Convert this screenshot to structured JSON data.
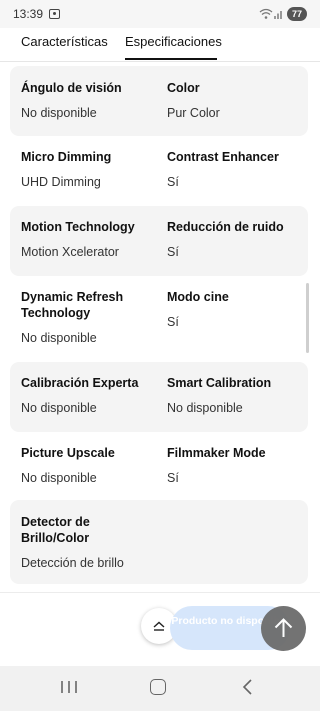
{
  "status_bar": {
    "time": "13:39",
    "battery": "77"
  },
  "tabs": [
    {
      "label": "Características"
    },
    {
      "label": "Especificaciones"
    }
  ],
  "specs": [
    {
      "cells": [
        {
          "label": "Ángulo de visión",
          "value": "No disponible"
        },
        {
          "label": "Color",
          "value": "Pur Color"
        }
      ]
    },
    {
      "cells": [
        {
          "label": "Micro Dimming",
          "value": "UHD Dimming"
        },
        {
          "label": "Contrast Enhancer",
          "value": "Sí"
        }
      ]
    },
    {
      "cells": [
        {
          "label": "Motion Technology",
          "value": "Motion Xcelerator"
        },
        {
          "label": "Reducción de ruido",
          "value": "Sí"
        }
      ]
    },
    {
      "cells": [
        {
          "label": "Dynamic Refresh Technology",
          "value": "No disponible"
        },
        {
          "label": "Modo cine",
          "value": "Sí"
        }
      ]
    },
    {
      "cells": [
        {
          "label": "Calibración Experta",
          "value": "No disponible"
        },
        {
          "label": "Smart Calibration",
          "value": "No disponible"
        }
      ]
    },
    {
      "cells": [
        {
          "label": "Picture Upscale",
          "value": "No disponible"
        },
        {
          "label": "Filmmaker Mode",
          "value": "Sí"
        }
      ]
    },
    {
      "cells": [
        {
          "label": "Detector de Brillo/Color",
          "value": "Detección de brillo"
        }
      ]
    }
  ],
  "bottom": {
    "unavailable_label": "Producto no disponible",
    "up_icon": "chevron-up-icon",
    "fab_icon": "arrow-up-icon"
  },
  "colors": {
    "row_shade": "#f4f4f4",
    "unavailable_bg": "#d6e6fb",
    "fab_bg": "#6c6c6c"
  }
}
